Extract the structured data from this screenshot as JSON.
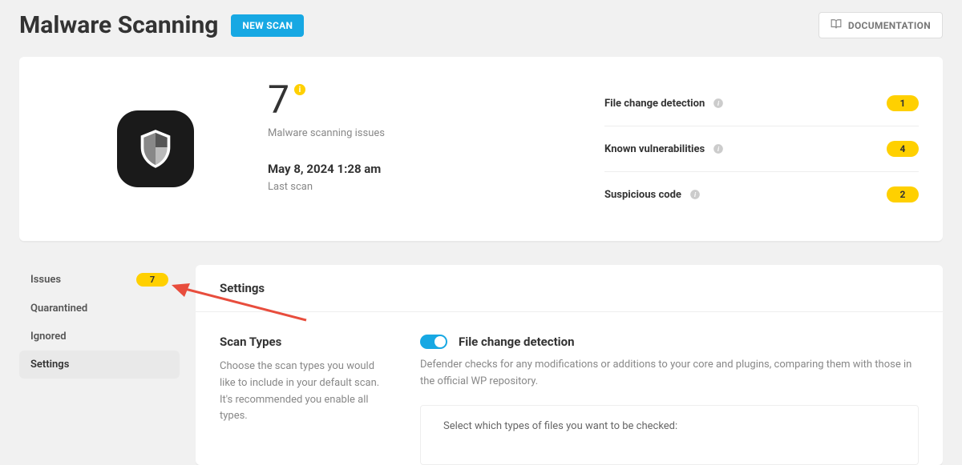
{
  "header": {
    "title": "Malware Scanning",
    "new_scan": "NEW SCAN",
    "docs": "DOCUMENTATION"
  },
  "summary": {
    "issue_count": "7",
    "issue_label": "Malware scanning issues",
    "last_scan_time": "May 8, 2024 1:28 am",
    "last_scan_label": "Last scan",
    "stats": [
      {
        "label": "File change detection",
        "count": "1"
      },
      {
        "label": "Known vulnerabilities",
        "count": "4"
      },
      {
        "label": "Suspicious code",
        "count": "2"
      }
    ]
  },
  "sidebar": {
    "items": [
      {
        "label": "Issues",
        "badge": "7",
        "active": false
      },
      {
        "label": "Quarantined",
        "active": false
      },
      {
        "label": "Ignored",
        "active": false
      },
      {
        "label": "Settings",
        "active": true
      }
    ]
  },
  "content": {
    "title": "Settings",
    "scan_types": {
      "heading": "Scan Types",
      "description": "Choose the scan types you would like to include in your default scan. It's recommended you enable all types."
    },
    "file_change": {
      "label": "File change detection",
      "description": "Defender checks for any modifications or additions to your core and plugins, comparing them with those in the official WP repository.",
      "box_text": "Select which types of files you want to be checked:"
    }
  },
  "colors": {
    "accent_blue": "#17a8e3",
    "accent_yellow": "#ffd000",
    "arrow_red": "#e84d3d"
  }
}
